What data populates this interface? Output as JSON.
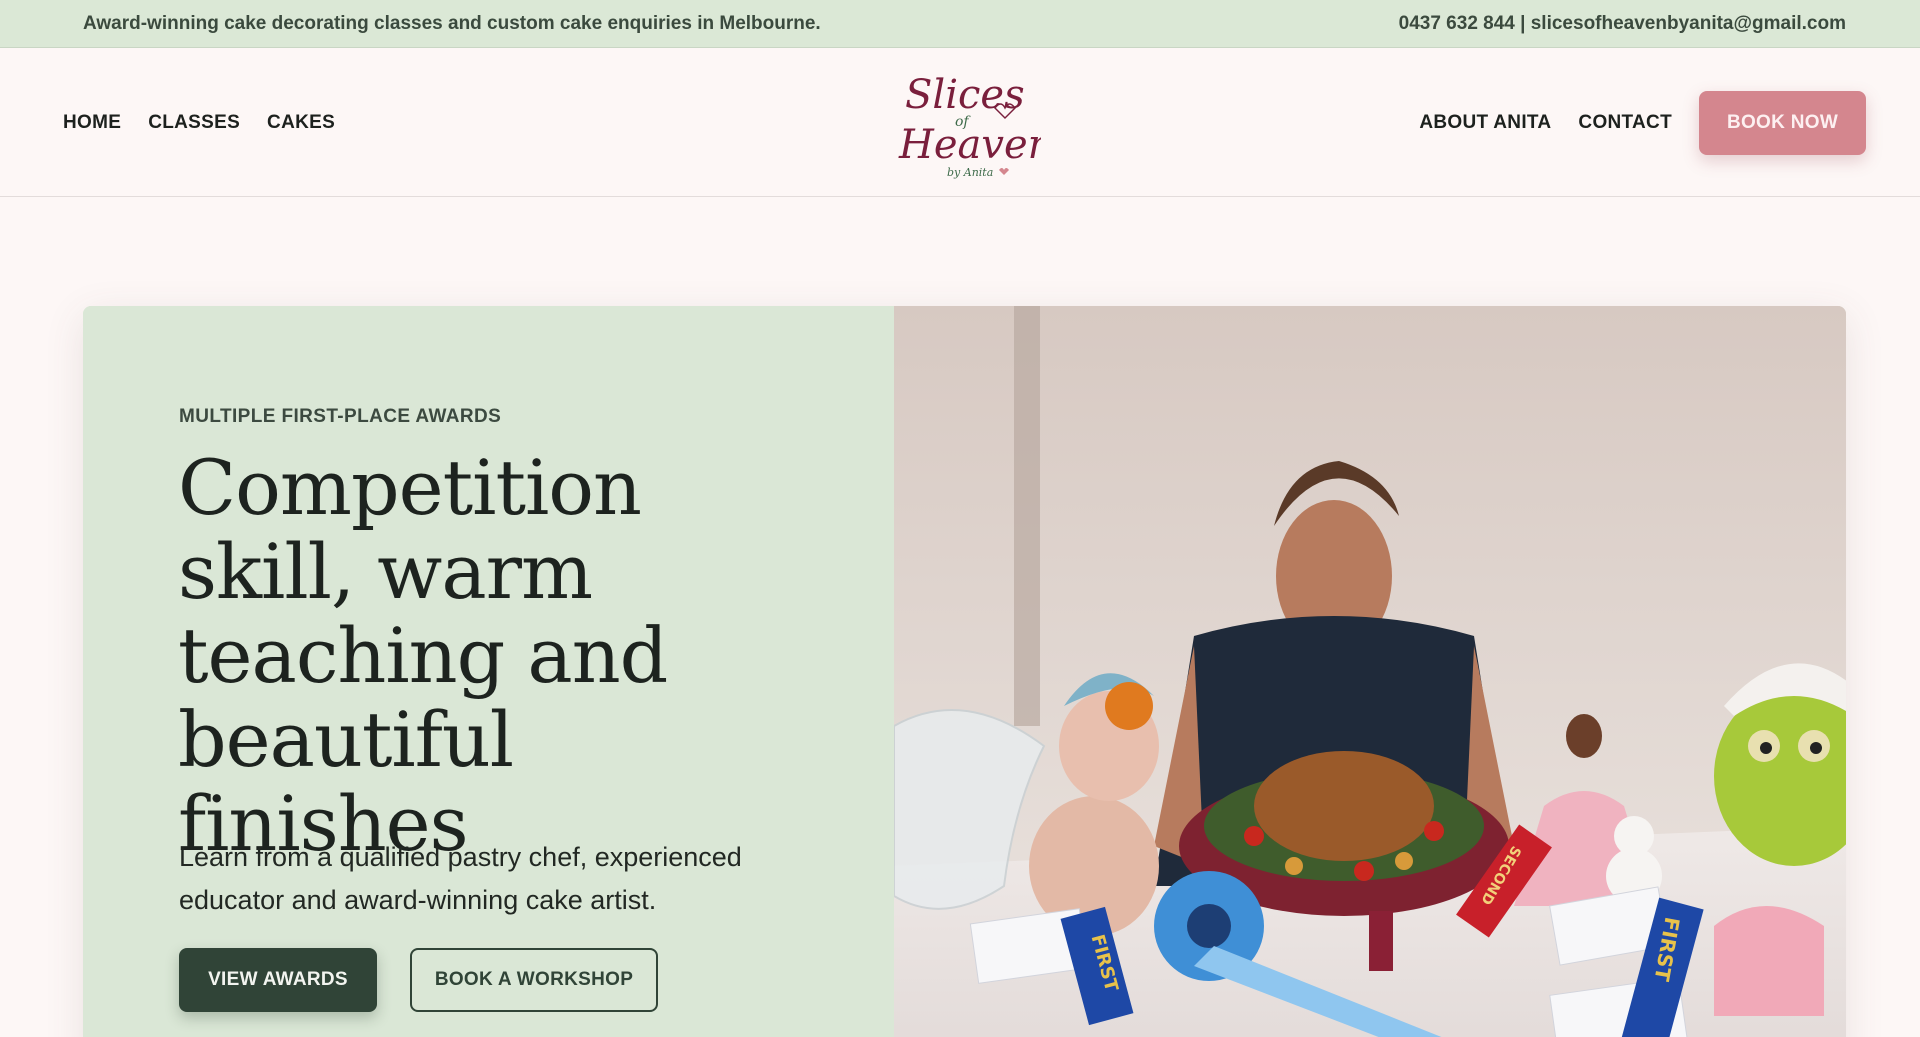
{
  "topbar": {
    "tagline": "Award-winning cake decorating classes and custom cake enquiries in Melbourne.",
    "contact": "0437 632 844 | slicesofheavenbyanita@gmail.com"
  },
  "nav": {
    "left": [
      "HOME",
      "CLASSES",
      "CAKES"
    ],
    "right": [
      "ABOUT ANITA",
      "CONTACT"
    ],
    "cta": "BOOK NOW"
  },
  "logo": {
    "line1": "Slices",
    "line2": "of",
    "line3": "Heaven",
    "line4": "by Anita",
    "color": "#7a1f3c"
  },
  "hero": {
    "eyebrow": "MULTIPLE FIRST-PLACE AWARDS",
    "headline": "Competition skill, warm teaching and beautiful finishes",
    "lead": "Learn from a qualified pastry chef, experienced educator and award-winning cake artist.",
    "primary_button": "VIEW AWARDS",
    "secondary_button": "BOOK A WORKSHOP",
    "photo_ribbons": [
      "FIRST",
      "FIRST",
      "SECOND"
    ]
  },
  "colors": {
    "topbar_bg": "#dbe8d6",
    "page_bg": "#fdf7f6",
    "accent_pink": "#d4868e",
    "dark_green": "#304437",
    "hero_panel": "#dae7d6"
  }
}
